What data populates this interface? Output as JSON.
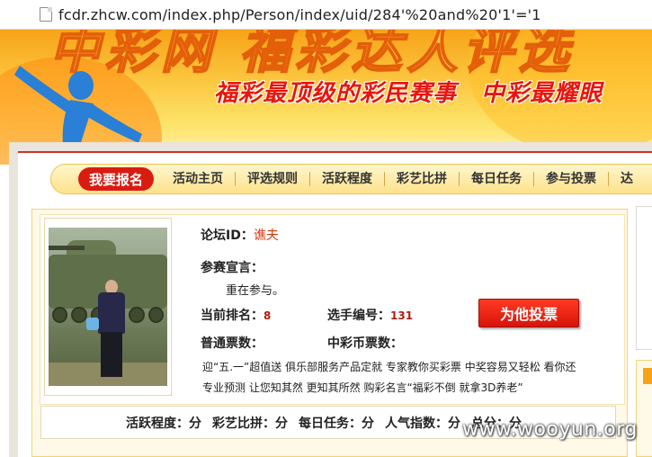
{
  "browser": {
    "url": "fcdr.zhcw.com/index.php/Person/index/uid/284'%20and%20'1'='1"
  },
  "banner": {
    "title": "中彩网 福彩达人评选",
    "slogan": "福彩最顶级的彩民赛事　中彩最耀眼"
  },
  "nav": {
    "register_label": "我要报名",
    "items": [
      {
        "label": "活动主页"
      },
      {
        "label": "评选规则"
      },
      {
        "label": "活跃程度"
      },
      {
        "label": "彩艺比拼"
      },
      {
        "label": "每日任务"
      },
      {
        "label": "参与投票"
      },
      {
        "label": "达"
      }
    ]
  },
  "profile": {
    "forum_id_label": "论坛ID：",
    "forum_id_value": "谯夫",
    "declaration_label": "参赛宣言：",
    "declaration_text": "重在参与。",
    "rank_label": "当前排名：",
    "rank_value": "8",
    "player_no_label": "选手编号：",
    "player_no_value": "131",
    "vote_button": "为他投票",
    "normal_votes_label": "普通票数：",
    "coin_votes_label": "中彩币票数：",
    "ad_line_1": "迎“五.一”超值送  俱乐部服务产品定就  专家教你买彩票  中奖容易又轻松  看你还",
    "ad_line_2": "专业预测  让您知其然  更知其所然          购彩名言“福彩不倒 就拿3D养老”"
  },
  "stats": {
    "activity": "活跃程度：分",
    "art": "彩艺比拼：分",
    "daily": "每日任务：分",
    "popularity": "人气指数：分",
    "total": "总分：分"
  },
  "watermark": "www.wooyun.org",
  "icons": {
    "page": "page-icon",
    "banner_figure": "running-figure-icon"
  },
  "colors": {
    "accent_red": "#d91c12",
    "banner_orange": "#f7a318",
    "nav_yellow": "#fde28a"
  }
}
